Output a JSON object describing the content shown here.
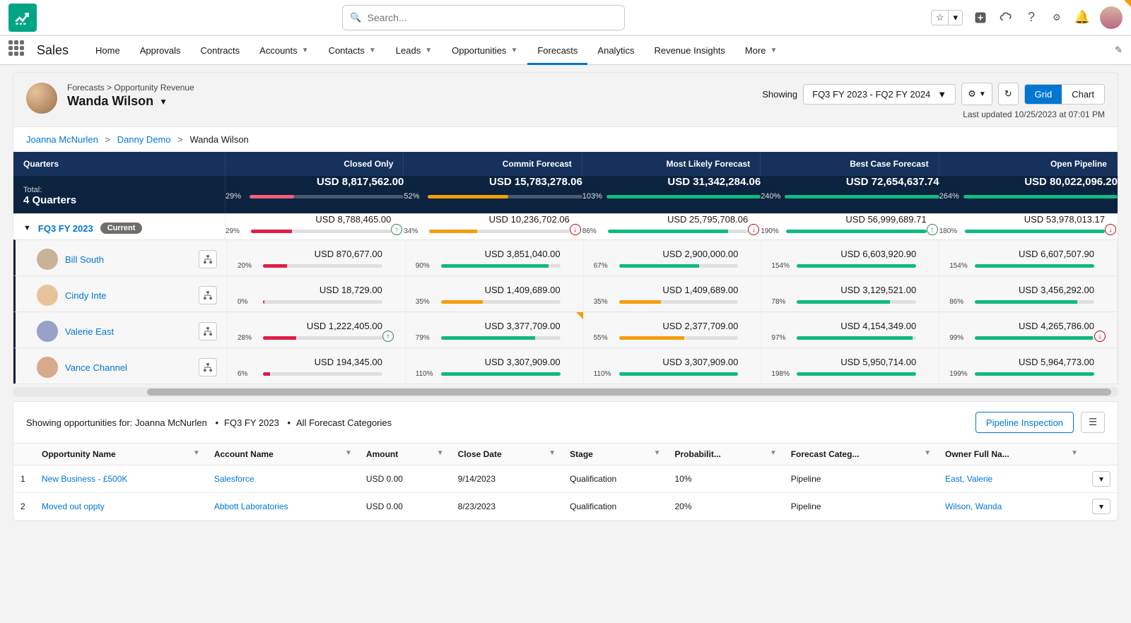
{
  "top": {
    "search_placeholder": "Search..."
  },
  "nav": {
    "app_name": "Sales",
    "items": [
      "Home",
      "Approvals",
      "Contracts",
      "Accounts",
      "Contacts",
      "Leads",
      "Opportunities",
      "Forecasts",
      "Analytics",
      "Revenue Insights",
      "More"
    ],
    "active": "Forecasts",
    "with_chevron": [
      "Accounts",
      "Contacts",
      "Leads",
      "Opportunities",
      "More"
    ]
  },
  "page_header": {
    "breadcrumb": "Forecasts > Opportunity Revenue",
    "owner_name": "Wanda Wilson",
    "showing_label": "Showing",
    "range": "FQ3 FY 2023 - FQ2 FY 2024",
    "view_grid": "Grid",
    "view_chart": "Chart",
    "last_updated": "Last updated 10/25/2023 at 07:01 PM"
  },
  "drill_path": {
    "root": "Joanna McNurlen",
    "mid": "Danny Demo",
    "leaf": "Wanda Wilson"
  },
  "grid": {
    "col0": "Quarters",
    "cols": [
      "Closed Only",
      "Commit Forecast",
      "Most Likely Forecast",
      "Best Case Forecast",
      "Open Pipeline"
    ],
    "total_label_small": "Total:",
    "total_label": "4 Quarters",
    "total_cells": [
      {
        "amount": "USD 8,817,562.00",
        "pct": "29%",
        "fill": 29,
        "color": "#ff5c7c",
        "flag": false
      },
      {
        "amount": "USD 15,783,278.06",
        "pct": "52%",
        "fill": 52,
        "color": "#f59e0b",
        "flag": true
      },
      {
        "amount": "USD 31,342,284.06",
        "pct": "103%",
        "fill": 100,
        "color": "#10b981",
        "flag": false
      },
      {
        "amount": "USD 72,654,637.74",
        "pct": "240%",
        "fill": 100,
        "color": "#10b981",
        "flag": false
      },
      {
        "amount": "USD 80,022,096.20",
        "pct": "264%",
        "fill": 100,
        "color": "#10b981",
        "flag": false
      }
    ],
    "quarter_row": {
      "label": "FQ3 FY 2023",
      "badge": "Current",
      "cells": [
        {
          "amount": "USD 8,788,465.00",
          "pct": "29%",
          "fill": 29,
          "color": "#e11d48",
          "trend": "up"
        },
        {
          "amount": "USD 10,236,702.06",
          "pct": "34%",
          "fill": 34,
          "color": "#f59e0b",
          "trend": "down"
        },
        {
          "amount": "USD 25,795,708.06",
          "pct": "86%",
          "fill": 86,
          "color": "#10b981",
          "trend": "down"
        },
        {
          "amount": "USD 56,999,689.71",
          "pct": "190%",
          "fill": 100,
          "color": "#10b981",
          "trend": "up"
        },
        {
          "amount": "USD 53,978,013.17",
          "pct": "180%",
          "fill": 100,
          "color": "#10b981",
          "trend": "down"
        }
      ]
    },
    "rows": [
      {
        "name": "Bill South",
        "avatar": "#c8b29a",
        "cells": [
          {
            "amount": "USD 870,677.00",
            "pct": "20%",
            "fill": 20,
            "color": "#e11d48"
          },
          {
            "amount": "USD 3,851,040.00",
            "pct": "90%",
            "fill": 90,
            "color": "#10b981"
          },
          {
            "amount": "USD 2,900,000.00",
            "pct": "67%",
            "fill": 67,
            "color": "#10b981"
          },
          {
            "amount": "USD 6,603,920.90",
            "pct": "154%",
            "fill": 100,
            "color": "#10b981"
          },
          {
            "amount": "USD 6,607,507.90",
            "pct": "154%",
            "fill": 100,
            "color": "#10b981"
          }
        ]
      },
      {
        "name": "Cindy Inte",
        "avatar": "#e8c49a",
        "cells": [
          {
            "amount": "USD 18,729.00",
            "pct": "0%",
            "fill": 1,
            "color": "#e11d48"
          },
          {
            "amount": "USD 1,409,689.00",
            "pct": "35%",
            "fill": 35,
            "color": "#f59e0b"
          },
          {
            "amount": "USD 1,409,689.00",
            "pct": "35%",
            "fill": 35,
            "color": "#f59e0b"
          },
          {
            "amount": "USD 3,129,521.00",
            "pct": "78%",
            "fill": 78,
            "color": "#10b981"
          },
          {
            "amount": "USD 3,456,292.00",
            "pct": "86%",
            "fill": 86,
            "color": "#10b981"
          }
        ]
      },
      {
        "name": "Valerie East",
        "avatar": "#9aa1c8",
        "flag_col": 1,
        "cells": [
          {
            "amount": "USD 1,222,405.00",
            "pct": "28%",
            "fill": 28,
            "color": "#e11d48",
            "trend": "up"
          },
          {
            "amount": "USD 3,377,709.00",
            "pct": "79%",
            "fill": 79,
            "color": "#10b981"
          },
          {
            "amount": "USD 2,377,709.00",
            "pct": "55%",
            "fill": 55,
            "color": "#f59e0b"
          },
          {
            "amount": "USD 4,154,349.00",
            "pct": "97%",
            "fill": 97,
            "color": "#10b981"
          },
          {
            "amount": "USD 4,265,786.00",
            "pct": "99%",
            "fill": 99,
            "color": "#10b981",
            "trend": "down"
          }
        ]
      },
      {
        "name": "Vance Channel",
        "avatar": "#d8a98a",
        "cells": [
          {
            "amount": "USD 194,345.00",
            "pct": "6%",
            "fill": 6,
            "color": "#e11d48"
          },
          {
            "amount": "USD 3,307,909.00",
            "pct": "110%",
            "fill": 100,
            "color": "#10b981"
          },
          {
            "amount": "USD 3,307,909.00",
            "pct": "110%",
            "fill": 100,
            "color": "#10b981"
          },
          {
            "amount": "USD 5,950,714.00",
            "pct": "198%",
            "fill": 100,
            "color": "#10b981"
          },
          {
            "amount": "USD 5,964,773.00",
            "pct": "199%",
            "fill": 100,
            "color": "#10b981"
          }
        ]
      }
    ]
  },
  "opps": {
    "showing_prefix": "Showing opportunities for: ",
    "filter_owner": "Joanna McNurlen",
    "filter_period": "FQ3 FY 2023",
    "filter_cat": "All Forecast Categories",
    "pipeline_btn": "Pipeline Inspection",
    "columns": [
      "Opportunity Name",
      "Account Name",
      "Amount",
      "Close Date",
      "Stage",
      "Probabilit...",
      "Forecast Categ...",
      "Owner Full Na..."
    ],
    "rows": [
      {
        "num": "1",
        "opp": "New Business - £500K",
        "acct": "Salesforce",
        "amt": "USD 0.00",
        "close": "9/14/2023",
        "stage": "Qualification",
        "prob": "10%",
        "cat": "Pipeline",
        "owner": "East, Valerie"
      },
      {
        "num": "2",
        "opp": "Moved out oppty",
        "acct": "Abbott Laboratories",
        "amt": "USD 0.00",
        "close": "8/23/2023",
        "stage": "Qualification",
        "prob": "20%",
        "cat": "Pipeline",
        "owner": "Wilson, Wanda"
      }
    ]
  }
}
